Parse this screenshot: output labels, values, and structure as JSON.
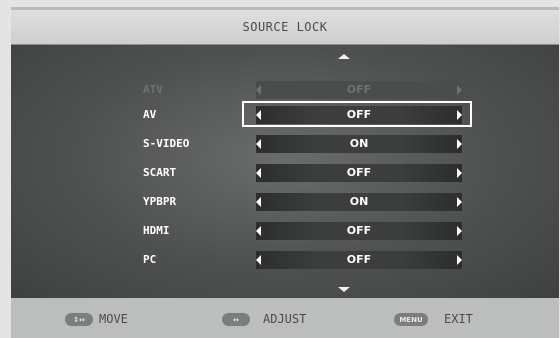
{
  "title": "SOURCE LOCK",
  "items": [
    {
      "label": "ATV",
      "value": "OFF",
      "state": "dim"
    },
    {
      "label": "AV",
      "value": "OFF",
      "state": "selected"
    },
    {
      "label": "S-VIDEO",
      "value": "ON",
      "state": "normal"
    },
    {
      "label": "SCART",
      "value": "OFF",
      "state": "normal"
    },
    {
      "label": "YPBPR",
      "value": "ON",
      "state": "normal"
    },
    {
      "label": "HDMI",
      "value": "OFF",
      "state": "normal"
    },
    {
      "label": "PC",
      "value": "OFF",
      "state": "normal"
    }
  ],
  "footer": {
    "move_key": "↕↔",
    "move_label": "MOVE",
    "adjust_key": "↔",
    "adjust_label": "ADJUST",
    "menu_key": "MENU",
    "exit_label": "EXIT"
  },
  "colors": {
    "panel": "#4f5151",
    "highlight": "#ffffff",
    "dimmed": "#6f7373"
  }
}
